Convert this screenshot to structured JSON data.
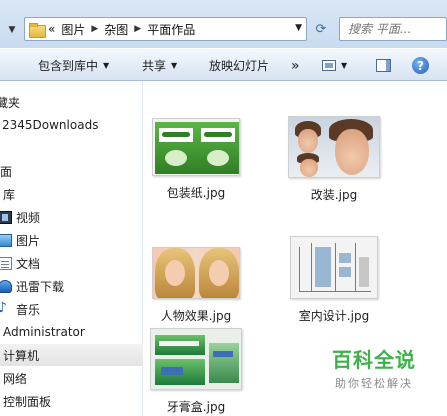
{
  "address_bar": {
    "overflow_chevron": "«",
    "breadcrumbs": [
      "图片",
      "杂图",
      "平面作品"
    ],
    "search_placeholder": "搜索 平面..."
  },
  "toolbar": {
    "include_in_library": "包含到库中",
    "share": "共享",
    "slideshow": "放映幻灯片",
    "more": "»",
    "help": "?"
  },
  "sidebar": {
    "favorites_partial": "收藏夹",
    "downloads": "2345Downloads",
    "desktop_partial": "桌面",
    "libraries_partial": "库",
    "video": "视频",
    "pictures": "图片",
    "documents": "文档",
    "thunder": "迅雷下载",
    "music": "音乐",
    "user": "Administrator",
    "computer": "计算机",
    "network": "网络",
    "control_panel": "控制面板"
  },
  "files": [
    {
      "name": "包装纸.jpg"
    },
    {
      "name": "改装.jpg"
    },
    {
      "name": "人物效果.jpg"
    },
    {
      "name": "室内设计.jpg"
    },
    {
      "name": "牙膏盒.jpg"
    }
  ],
  "watermark": {
    "main": "百科全说",
    "sub": "助你轻松解决"
  },
  "colors": {
    "toolbar_bg": "#dce7f4",
    "selected_item": "#e6e6e6",
    "logo_green": "#3db24a"
  }
}
